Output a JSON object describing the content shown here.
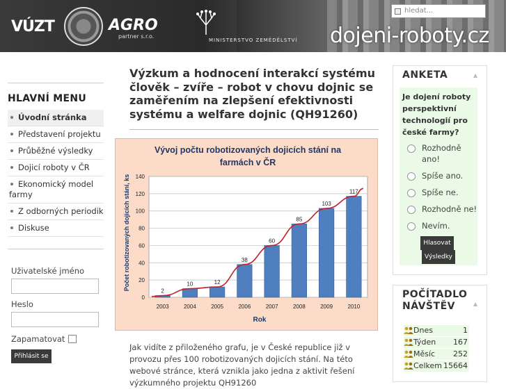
{
  "header": {
    "logo_vuzt": "VÚZT",
    "logo_agro": "AGRO",
    "logo_agro_sub": "partner s.r.o.",
    "ministry": "MINISTERSTVO ZEMĚDĚLSTVÍ",
    "site_title": "dojeni-roboty.cz",
    "search_placeholder": "hledat..."
  },
  "sidebar": {
    "menu_title": "HLAVNÍ MENU",
    "items": [
      {
        "label": "Úvodní stránka"
      },
      {
        "label": "Představení projektu"
      },
      {
        "label": "Průběžné výsledky"
      },
      {
        "label": "Dojicí roboty v ČR"
      },
      {
        "label": "Ekonomický model farmy"
      },
      {
        "label": "Z odborných periodik"
      },
      {
        "label": "Diskuse"
      }
    ],
    "login": {
      "username_label": "Uživatelské jméno",
      "password_label": "Heslo",
      "remember_label": "Zapamatovat si",
      "submit_label": "Přihlásit se"
    }
  },
  "article": {
    "title": "Výzkum a hodnocení interakcí systému člověk – zvíře – robot v chovu dojnic se zaměřením na zlepšení efektivnosti systému a welfare dojnic (QH91260)",
    "body": "Jak vidíte z přiloženého grafu, je v České republice již v provozu přes 100 robotizovaných dojicích stání. Na této webové stránce, která vznikla jako jedna z aktivit řešení výzkumného projektu QH91260"
  },
  "chart_data": {
    "type": "bar",
    "title_line1": "Vývoj počtu robotizovaných dojicích stání na",
    "title_line2": "farmách v ČR",
    "xlabel": "Rok",
    "ylabel": "Počet robotizovaných dojicích stání, ks",
    "categories": [
      "2003",
      "2004",
      "2005",
      "2006",
      "2007",
      "2008",
      "2009",
      "2010"
    ],
    "values": [
      2,
      10,
      12,
      38,
      60,
      85,
      103,
      117
    ],
    "ylim": [
      0,
      140
    ],
    "yticks": [
      0,
      20,
      40,
      60,
      80,
      100,
      120,
      140
    ],
    "bar_color": "#4f7fbf",
    "trend_color": "#c0202a",
    "grid": true
  },
  "poll": {
    "title": "ANKETA",
    "question": "Je dojení roboty perspektivní technologií pro české farmy?",
    "options": [
      {
        "label": "Rozhodně ano!"
      },
      {
        "label": "Spíše ano."
      },
      {
        "label": "Spíše ne."
      },
      {
        "label": "Rozhodně ne!"
      },
      {
        "label": "Nevím."
      }
    ],
    "vote_label": "Hlasovat",
    "results_label": "Výsledky"
  },
  "counter": {
    "title_line1": "POČÍTADLO",
    "title_line2": "NÁVŠTĚV",
    "rows": [
      {
        "label": "Dnes",
        "value": "1"
      },
      {
        "label": "Týden",
        "value": "167"
      },
      {
        "label": "Měsíc",
        "value": "252"
      },
      {
        "label": "Celkem",
        "value": "15664"
      }
    ]
  }
}
